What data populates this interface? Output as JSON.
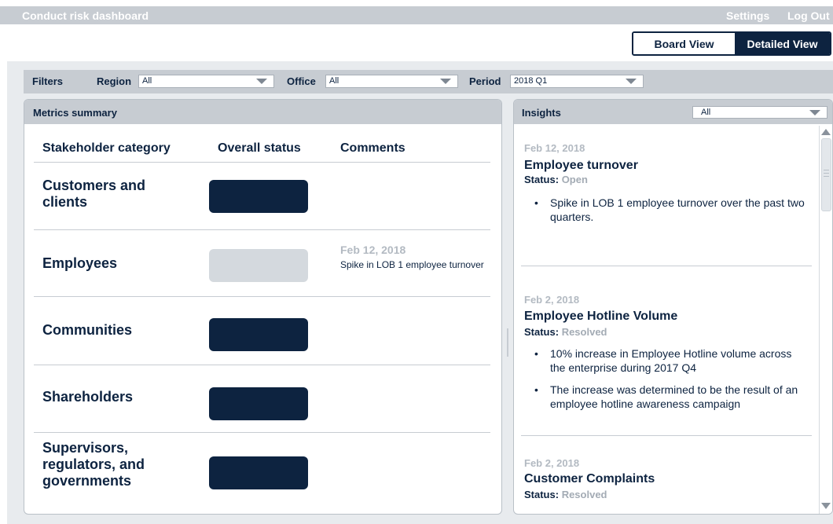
{
  "app": {
    "title": "Conduct risk dashboard",
    "settings_label": "Settings",
    "logout_label": "Log Out"
  },
  "view_toggle": {
    "board_label": "Board View",
    "detailed_label": "Detailed View",
    "active": "Detailed View"
  },
  "filters": {
    "title": "Filters",
    "region_label": "Region",
    "region_value": "All",
    "office_label": "Office",
    "office_value": "All",
    "period_label": "Period",
    "period_value": "2018 Q1"
  },
  "metrics": {
    "title": "Metrics summary",
    "columns": [
      "Stakeholder category",
      "Overall status",
      "Comments"
    ],
    "rows": [
      {
        "category": "Customers and clients",
        "status_color": "#0d2340",
        "comment_date": "",
        "comment_text": ""
      },
      {
        "category": "Employees",
        "status_color": "#d4d9de",
        "comment_date": "Feb 12, 2018",
        "comment_text": "Spike in LOB 1 employee turnover"
      },
      {
        "category": "Communities",
        "status_color": "#0d2340",
        "comment_date": "",
        "comment_text": ""
      },
      {
        "category": "Shareholders",
        "status_color": "#0d2340",
        "comment_date": "",
        "comment_text": ""
      },
      {
        "category": "Supervisors, regulators, and governments",
        "status_color": "#0d2340",
        "comment_date": "",
        "comment_text": ""
      }
    ]
  },
  "insights": {
    "title": "Insights",
    "filter_value": "All",
    "status_label": "Status:",
    "items": [
      {
        "date": "Feb 12, 2018",
        "title": "Employee turnover",
        "status": "Open",
        "bullets": [
          "Spike in LOB 1 employee turnover over the past two quarters."
        ]
      },
      {
        "date": "Feb 2, 2018",
        "title": "Employee Hotline Volume",
        "status": "Resolved",
        "bullets": [
          "10% increase in Employee Hotline volume across the enterprise during 2017 Q4",
          "The increase was determined to be the result of an employee hotline awareness campaign"
        ]
      },
      {
        "date": "Feb 2, 2018",
        "title": "Customer Complaints",
        "status": "Resolved",
        "bullets": []
      }
    ]
  },
  "icons": {
    "dropdown": "chevron-down-icon",
    "scroll_up": "arrow-up-icon",
    "scroll_down": "arrow-down-icon",
    "bullet": "•"
  }
}
